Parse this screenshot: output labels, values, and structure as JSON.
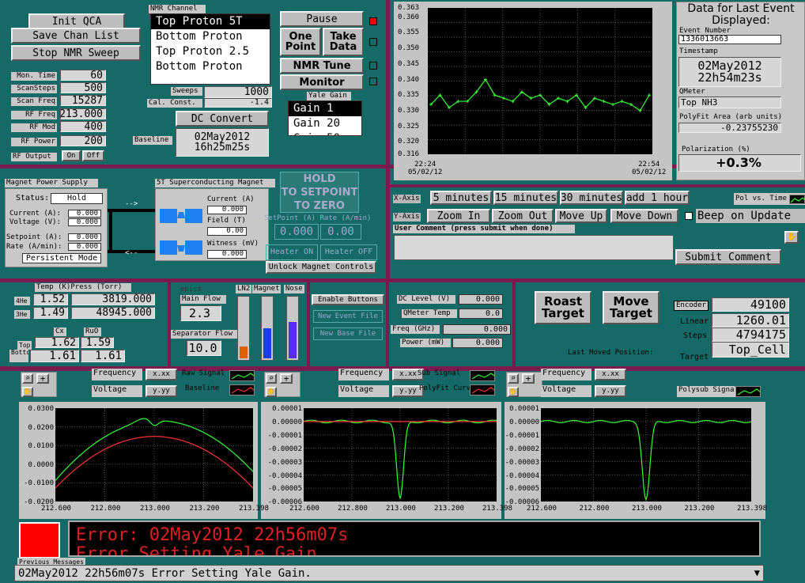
{
  "controls": {
    "init": "Init QCA",
    "save": "Save Chan List",
    "stop": "Stop NMR Sweep"
  },
  "params": [
    {
      "label": "Mon. Time",
      "value": "60"
    },
    {
      "label": "ScanSteps",
      "value": "500"
    },
    {
      "label": "Scan Freq",
      "value": "15287"
    },
    {
      "label": "RF Freq",
      "value": "213.000"
    },
    {
      "label": "RF Mod",
      "value": "400"
    },
    {
      "label": "RF Power",
      "value": "200"
    }
  ],
  "rf_output": {
    "label": "RF Output",
    "on": "On",
    "off": "Off"
  },
  "nmr_channel": {
    "title": "NMR Channel",
    "items": [
      "Top Proton 5T",
      "Bottom Proton",
      "Top Proton 2.5",
      "Bottom Proton"
    ],
    "selected": 0
  },
  "sweeps": {
    "label": "Sweeps",
    "value": "1000"
  },
  "cal_const": {
    "label": "Cal. Const.",
    "value": "-1.4"
  },
  "dc_convert": "DC Convert",
  "baseline": {
    "label": "Baseline",
    "date": "02May2012",
    "time": "16h25m25s"
  },
  "top_buttons": {
    "pause": "Pause",
    "one_point": "One Point",
    "take_data": "Take Data",
    "nmr_tune": "NMR Tune",
    "monitor": "Monitor"
  },
  "yale_gain": {
    "title": "Yale Gain",
    "items": [
      "Gain 1",
      "Gain 20",
      "Gain 50"
    ],
    "selected": 0
  },
  "pol_chart": {
    "yticks": [
      "0.363",
      "0.360",
      "0.355",
      "0.350",
      "0.345",
      "0.340",
      "0.335",
      "0.330",
      "0.325",
      "0.320",
      "0.316"
    ],
    "x_start": [
      "22:24",
      "05/02/12"
    ],
    "x_end": [
      "22:54",
      "05/02/12"
    ]
  },
  "chart_data": [
    {
      "type": "line",
      "ylim": [
        0.316,
        0.363
      ],
      "x_range": [
        "05/02/12 22:24",
        "05/02/12 22:54"
      ],
      "grid": true,
      "series": [
        {
          "color": "#33ff33",
          "values": [
            0.332,
            0.335,
            0.331,
            0.333,
            0.333,
            0.336,
            0.34,
            0.335,
            0.334,
            0.333,
            0.336,
            0.334,
            0.335,
            0.332,
            0.334,
            0.333,
            0.335,
            0.331,
            0.334,
            0.333,
            0.332,
            0.333,
            0.332,
            0.33,
            0.335
          ]
        }
      ]
    },
    {
      "type": "line",
      "xlim": [
        212.6,
        213.398
      ],
      "ylim": [
        -0.0203,
        0.0303
      ],
      "grid": true,
      "series": [
        {
          "color": "#33ff33"
        },
        {
          "color": "#ff3333"
        }
      ]
    },
    {
      "type": "line",
      "xlim": [
        212.6,
        213.398
      ],
      "ylim": [
        -6e-05,
        1e-05
      ],
      "grid": true,
      "series": [
        {
          "color": "#33ff33"
        },
        {
          "color": "#ff3333"
        }
      ]
    },
    {
      "type": "line",
      "xlim": [
        212.6,
        213.398
      ],
      "ylim": [
        -6e-05,
        1e-05
      ],
      "grid": true,
      "series": [
        {
          "color": "#33ff33"
        }
      ]
    }
  ],
  "last_event": {
    "title": "Data for Last Event Displayed:",
    "event_label": "Event Number",
    "event": "1336013663",
    "ts_label": "Timestamp",
    "ts_date": "02May2012",
    "ts_time": "22h54m23s",
    "qmeter_label": "QMeter",
    "qmeter": "Top NH3",
    "area_label": "PolyFit Area (arb units)",
    "area": "-0.23755230",
    "pol_label": "Polarization (%)",
    "pol": "+0.3%"
  },
  "xaxis": {
    "label": "X-Axis",
    "b": [
      "5 minutes",
      "15 minutes",
      "30 minutes",
      "add 1 hour"
    ]
  },
  "yaxis": {
    "label": "Y-Axis",
    "b": [
      "Zoom In",
      "Zoom Out",
      "Move Up",
      "Move Down"
    ]
  },
  "pol_vs_time": "Pol vs. Time",
  "beep": "Beep on Update",
  "user_comment": {
    "label": "User Comment (press submit when done)",
    "submit": "Submit Comment"
  },
  "magnet_ps": {
    "title": "Magnet Power Supply",
    "status_label": "Status:",
    "status": "Hold",
    "current_label": "Current (A):",
    "current": "0.000",
    "voltage_label": "Voltage (V):",
    "voltage": "0.000",
    "setpoint_label": "Setpoint (A):",
    "setpoint": "0.000",
    "rate_label": "Rate (A/min):",
    "rate": "0.000",
    "mode": "Persistent Mode"
  },
  "sc_magnet": {
    "title": "5T Superconducting Magnet",
    "current_label": "Current (A)",
    "current": "0.000",
    "field_label": "Field (T)",
    "field": "0.00",
    "witness_label": "Witness (mV)",
    "witness": "0.000"
  },
  "hold": {
    "hold": "HOLD",
    "setpoint": "TO SETPOINT",
    "zero": "TO ZERO",
    "sp_label": "SetPoint (A)",
    "rate_label": "Rate (A/min)",
    "sp": "0.000",
    "rate": "0.00",
    "heater_on": "Heater ON",
    "heater_off": "Heater OFF",
    "unlock": "Unlock Magnet Controls"
  },
  "temps": {
    "temp_label": "Temp (K)",
    "press_label": "Press (Torr)",
    "r4_label": "4He",
    "r4_t": "1.52",
    "r4_p": "3819.000",
    "r3_label": "3He",
    "r3_t": "1.49",
    "r3_p": "48945.000",
    "cx_label": "Cx",
    "ruo_label": "RuO",
    "top_label": "Top",
    "top_cx": "1.62",
    "top_ruo": "1.59",
    "bot_label": "Bottom",
    "bot_cx": "1.61",
    "bot_ruo": "1.61"
  },
  "epics": {
    "title": "epics",
    "main_flow_label": "Main Flow",
    "main_flow": "2.3",
    "sep_flow_label": "Separator Flow",
    "sep_flow": "10.0",
    "ln2": "LN2",
    "magnet": "Magnet",
    "nose": "Nose",
    "ln2_level": 0.2,
    "magnet_level": 0.5,
    "nose_level": 0.6
  },
  "file_buttons": {
    "enable": "Enable Buttons",
    "event": "New Event File",
    "base": "New Base File"
  },
  "meters": {
    "dc_label": "DC Level (V)",
    "dc": "0.000",
    "qt_label": "QMeter Temp",
    "qt": "0.0",
    "freq_label": "Freq (GHz)",
    "freq": "0.000",
    "power_label": "Power (mW)",
    "power": "0.000"
  },
  "target": {
    "roast": "Roast Target",
    "move": "Move Target",
    "last": "Last Moved Position:",
    "enc_label": "Encoder",
    "enc": "49100",
    "lin_label": "Linear",
    "lin": "1260.01",
    "steps_label": "Steps",
    "steps": "4794175",
    "tgt_label": "Target",
    "tgt": "Top_Cell"
  },
  "plot_ctrl": {
    "frequency": "Frequency",
    "voltage": "Voltage",
    "raw": "Raw Signal",
    "baseline": "Baseline",
    "sub": "Sub Signal",
    "polyfit": "PolyFit Curve",
    "polysub": "Polysub Signal"
  },
  "plot_axes": {
    "p1_y": [
      "0.0300",
      "0.0200",
      "0.0100",
      "0.0000",
      "-0.0100",
      "-0.0200"
    ],
    "p2_y": [
      "0.00001",
      "0.00000",
      "-0.00001",
      "-0.00002",
      "-0.00003",
      "-0.00004",
      "-0.00005",
      "-0.00006"
    ],
    "x": [
      "212.600",
      "212.800",
      "213.000",
      "213.200",
      "213.398"
    ]
  },
  "error": {
    "big1": "Error: 02May2012 22h56m07s",
    "big2": "Error Setting Yale Gain",
    "prev": "Previous Messages",
    "line": "02May2012 22h56m07s Error Setting Yale Gain."
  }
}
